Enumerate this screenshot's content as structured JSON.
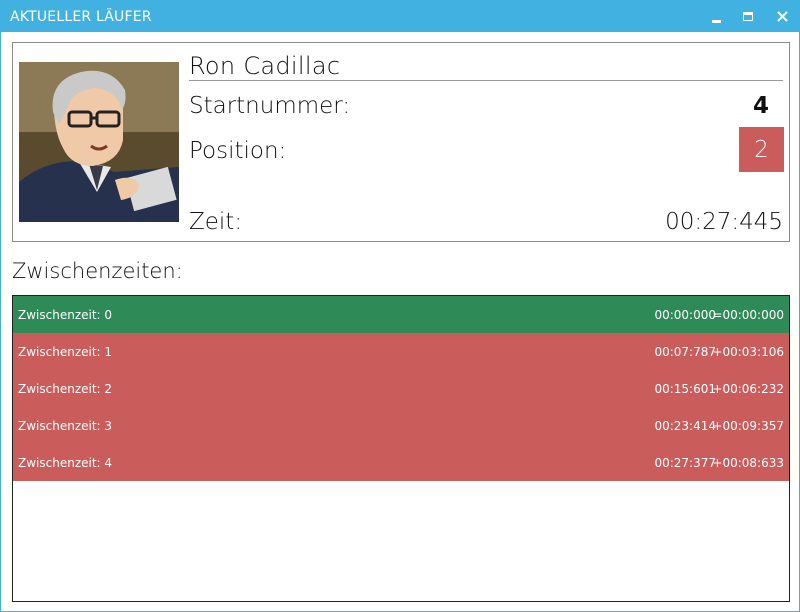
{
  "window": {
    "title": "AKTUELLER LÄUFER",
    "controls": [
      "minimize-icon",
      "maximize-icon",
      "close-icon"
    ],
    "accent_color": "#41b1e1"
  },
  "runner": {
    "name": "Ron Cadillac",
    "start_label": "Startnummer:",
    "start_number": "4",
    "position_label": "Position:",
    "position": "2",
    "position_color": "#cb5c5c",
    "time_label": "Zeit:",
    "time": "00:27:445"
  },
  "splits": {
    "heading": "Zwischenzeiten:",
    "rows": [
      {
        "label": "Zwischenzeit: 0",
        "time": "00:00:000",
        "diff": "=00:00:000",
        "status": "good"
      },
      {
        "label": "Zwischenzeit: 1",
        "time": "00:07:787",
        "diff": "+00:03:106",
        "status": "bad"
      },
      {
        "label": "Zwischenzeit: 2",
        "time": "00:15:601",
        "diff": "+00:06:232",
        "status": "bad"
      },
      {
        "label": "Zwischenzeit: 3",
        "time": "00:23:414",
        "diff": "+00:09:357",
        "status": "bad"
      },
      {
        "label": "Zwischenzeit: 4",
        "time": "00:27:377",
        "diff": "+00:08:633",
        "status": "bad"
      }
    ],
    "status_colors": {
      "good": "#2e8b57",
      "bad": "#cb5c5c"
    }
  }
}
